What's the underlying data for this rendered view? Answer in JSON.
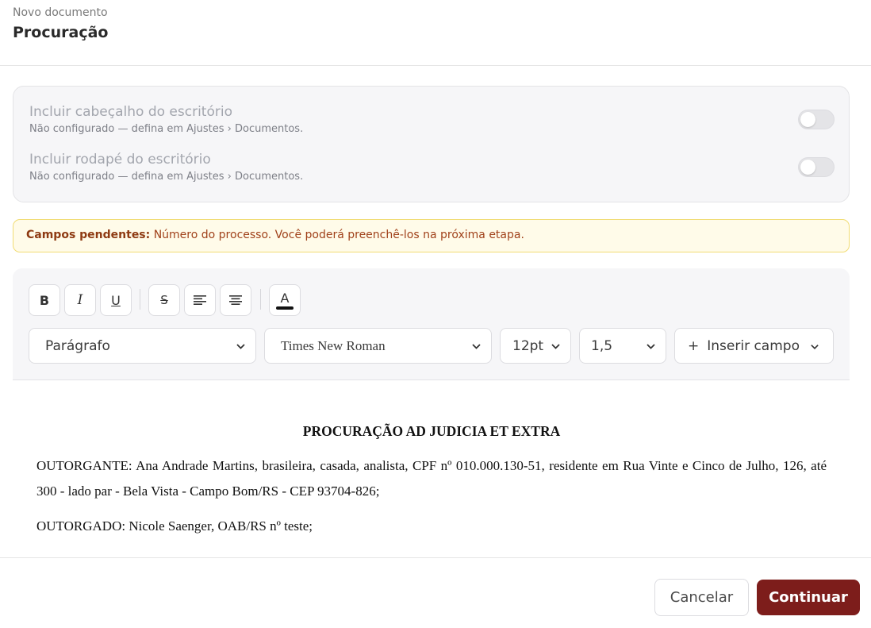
{
  "header": {
    "eyebrow": "Novo documento",
    "title": "Procuração"
  },
  "toggles": [
    {
      "label": "Incluir cabeçalho do escritório",
      "hint": "Não configurado — defina em Ajustes › Documentos.",
      "enabled": false
    },
    {
      "label": "Incluir rodapé do escritório",
      "hint": "Não configurado — defina em Ajustes › Documentos.",
      "enabled": false
    }
  ],
  "alert": {
    "label": "Campos pendentes:",
    "message": "Número do processo. Você poderá preenchê-los na próxima etapa."
  },
  "toolbar": {
    "bold": "B",
    "italic": "I",
    "underline": "U",
    "strikethrough": "S",
    "text_color": "A",
    "text_color_value": "#111111",
    "block_style": "Parágrafo",
    "font_family": "Times New Roman",
    "font_size": "12pt",
    "line_height": "1,5",
    "insert_field_plus": "+",
    "insert_field": "Inserir campo"
  },
  "document": {
    "title": "PROCURAÇÃO AD JUDICIA ET EXTRA",
    "paragraphs": [
      "OUTORGANTE: Ana Andrade Martins, brasileira, casada, analista, CPF nº 010.000.130-51, residente em Rua Vinte e Cinco de Julho, 126, até 300 - lado par - Bela Vista - Campo Bom/RS - CEP 93704-826;",
      "OUTORGADO: Nicole Saenger, OAB/RS nº teste;"
    ]
  },
  "footer": {
    "cancel": "Cancelar",
    "continue": "Continuar"
  },
  "colors": {
    "primary": "#7d1d1b",
    "alert_bg": "#fffbe9",
    "alert_border": "#f1dc74"
  }
}
